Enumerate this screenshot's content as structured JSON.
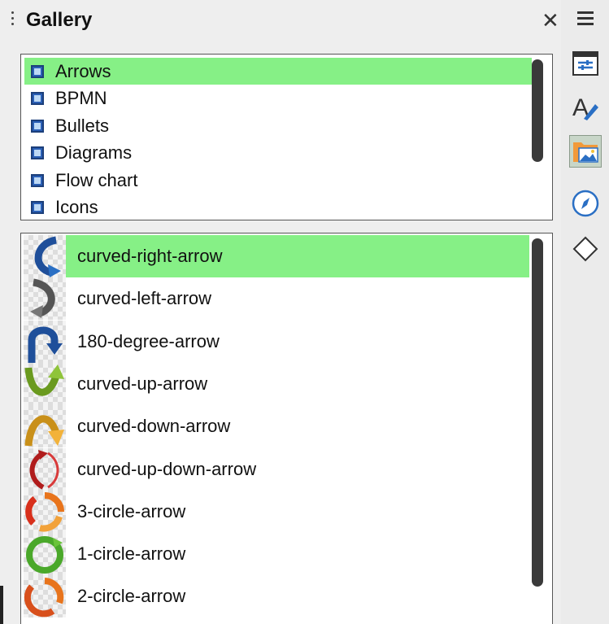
{
  "panel": {
    "title": "Gallery",
    "close_glyph": "✕"
  },
  "themes": [
    {
      "label": "Arrows",
      "selected": true
    },
    {
      "label": "BPMN",
      "selected": false
    },
    {
      "label": "Bullets",
      "selected": false
    },
    {
      "label": "Diagrams",
      "selected": false
    },
    {
      "label": "Flow chart",
      "selected": false
    },
    {
      "label": "Icons",
      "selected": false
    }
  ],
  "items": [
    {
      "label": "curved-right-arrow",
      "icon": "curved-right-arrow-icon",
      "selected": true
    },
    {
      "label": "curved-left-arrow",
      "icon": "curved-left-arrow-icon",
      "selected": false
    },
    {
      "label": "180-degree-arrow",
      "icon": "180-degree-arrow-icon",
      "selected": false
    },
    {
      "label": "curved-up-arrow",
      "icon": "curved-up-arrow-icon",
      "selected": false
    },
    {
      "label": "curved-down-arrow",
      "icon": "curved-down-arrow-icon",
      "selected": false
    },
    {
      "label": "curved-up-down-arrow",
      "icon": "curved-up-down-arrow-icon",
      "selected": false
    },
    {
      "label": "3-circle-arrow",
      "icon": "3-circle-arrow-icon",
      "selected": false
    },
    {
      "label": "1-circle-arrow",
      "icon": "1-circle-arrow-icon",
      "selected": false
    },
    {
      "label": "2-circle-arrow",
      "icon": "2-circle-arrow-icon",
      "selected": false
    }
  ],
  "sidebar": {
    "buttons": [
      {
        "name": "properties",
        "icon": "properties-icon"
      },
      {
        "name": "styles",
        "icon": "styles-icon"
      },
      {
        "name": "gallery",
        "icon": "gallery-icon",
        "active": true
      },
      {
        "name": "navigator",
        "icon": "navigator-icon"
      },
      {
        "name": "shapes",
        "icon": "shapes-icon"
      }
    ]
  },
  "colors": {
    "selection": "#86f086",
    "accent_blue": "#2a6fc4"
  }
}
